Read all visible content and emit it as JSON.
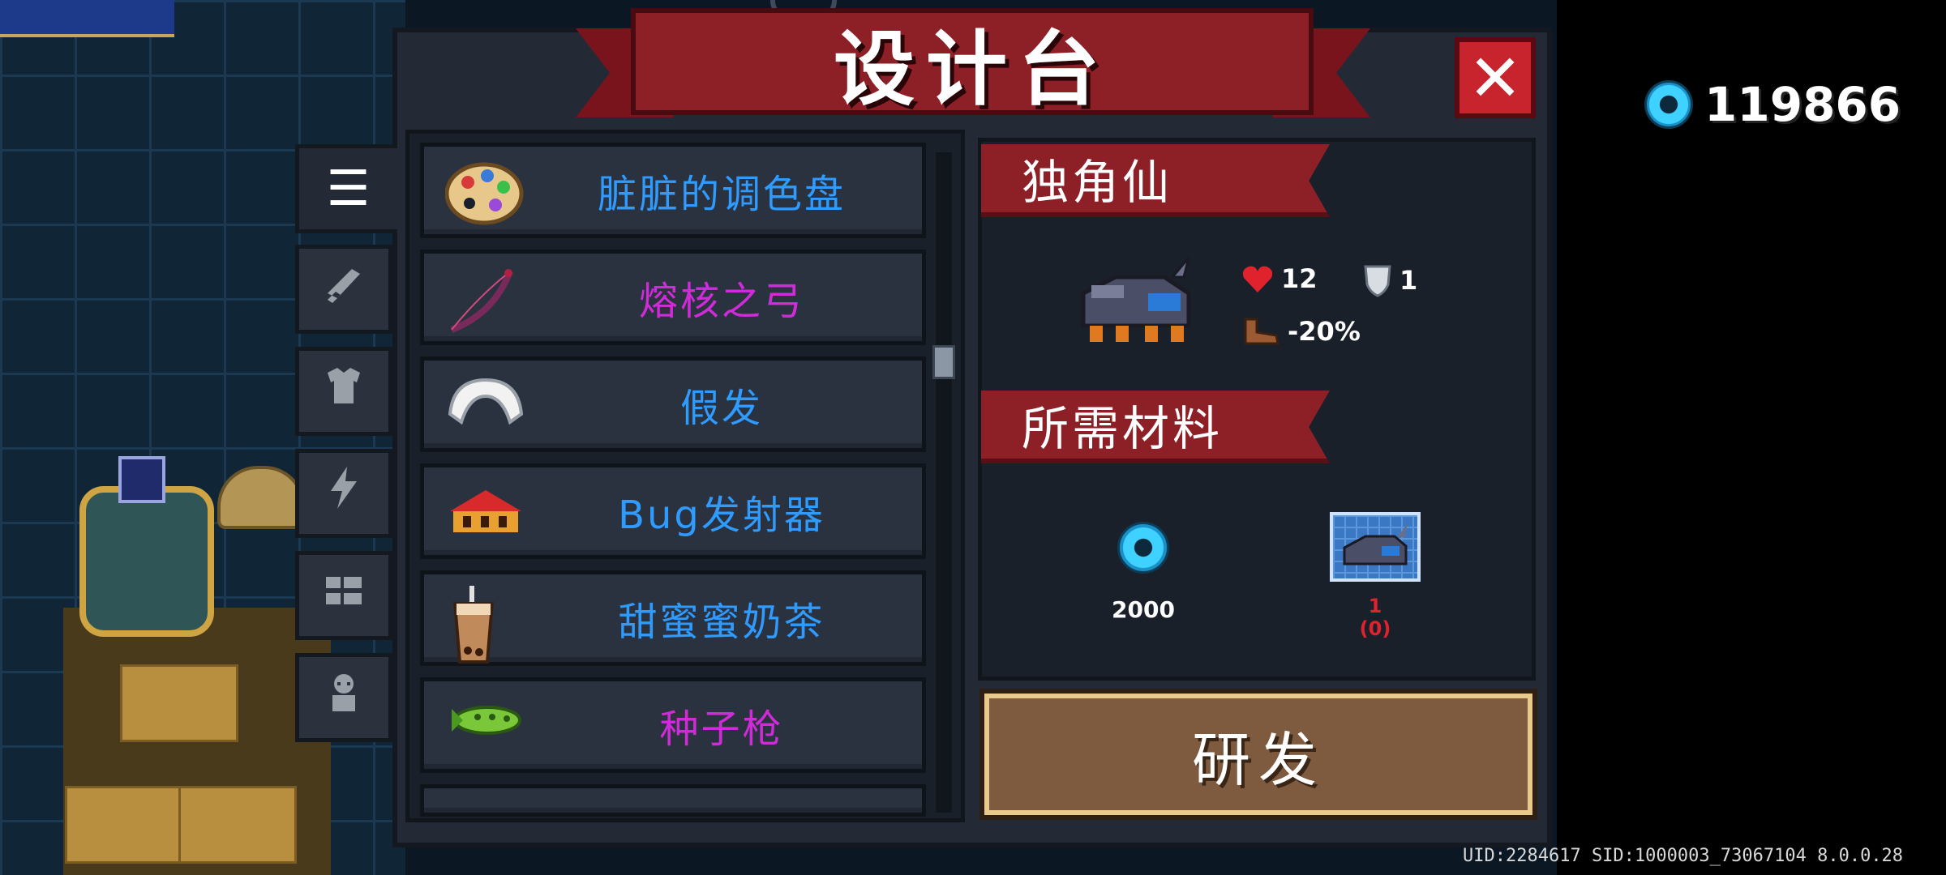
{
  "title": "设计台",
  "currency": {
    "icon": "gem-icon",
    "value": "119866"
  },
  "close_icon": "close-icon",
  "tabs": [
    {
      "icon": "list-icon",
      "active": true
    },
    {
      "icon": "weapon-icon",
      "active": false
    },
    {
      "icon": "armor-icon",
      "active": false
    },
    {
      "icon": "lightning-icon",
      "active": false
    },
    {
      "icon": "pet-icon",
      "active": false
    },
    {
      "icon": "character-icon",
      "active": false
    }
  ],
  "items": [
    {
      "label": "脏脏的调色盘",
      "color": "#2f9bff",
      "icon": "palette-icon"
    },
    {
      "label": "熔核之弓",
      "color": "#d02bd8",
      "icon": "bow-icon"
    },
    {
      "label": "假发",
      "color": "#2f9bff",
      "icon": "wig-icon"
    },
    {
      "label": "Bug发射器",
      "color": "#2f9bff",
      "icon": "bug-launcher-icon"
    },
    {
      "label": "甜蜜蜜奶茶",
      "color": "#2f9bff",
      "icon": "milk-tea-icon"
    },
    {
      "label": "种子枪",
      "color": "#d02bd8",
      "icon": "seed-gun-icon"
    }
  ],
  "detail": {
    "name": "独角仙",
    "hp": "12",
    "armor": "1",
    "speed": "-20%",
    "materials_title": "所需材料",
    "gem_cost": "2000",
    "blueprint_count": "1",
    "blueprint_owned": "(0)",
    "research_label": "研发"
  },
  "footer": "UID:2284617 SID:1000003_73067104 8.0.0.28"
}
